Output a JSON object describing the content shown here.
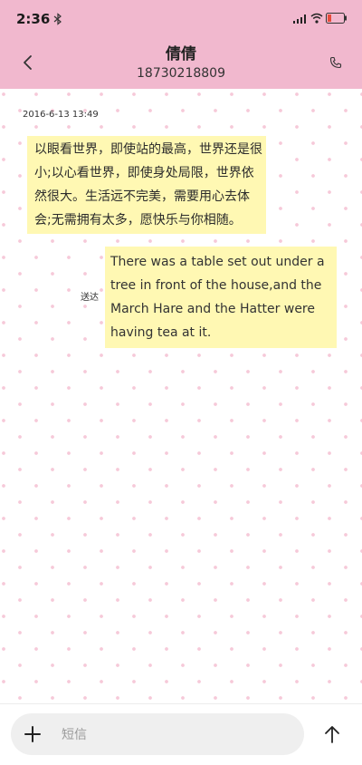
{
  "status_bar": {
    "time": "2:36",
    "icons": [
      "bluetooth-icon",
      "signal-icon",
      "wifi-icon",
      "battery-icon"
    ]
  },
  "header": {
    "contact_name": "倩倩",
    "contact_number": "18730218809",
    "back_icon": "chevron-left-icon",
    "call_icon": "phone-icon",
    "background_color": "#f1b8ce"
  },
  "conversation": {
    "timestamp": "2016-6-13 13:49",
    "messages": [
      {
        "direction": "received",
        "text": "以眼看世界，即使站的最高，世界还是很小;以心看世界，即使身处局限，世界依然很大。生活远不完美，需要用心去体会;无需拥有太多，愿快乐与你相随。"
      },
      {
        "direction": "sent",
        "status": "送达",
        "text": "There was a table set out under a tree in front of the house,and the March Hare and the Hatter were having tea at it."
      }
    ],
    "bubble_color": "#fff8b3",
    "dot_color": "#f6c9d9"
  },
  "composer": {
    "placeholder": "短信",
    "add_icon": "plus-icon",
    "send_icon": "arrow-up-icon"
  }
}
